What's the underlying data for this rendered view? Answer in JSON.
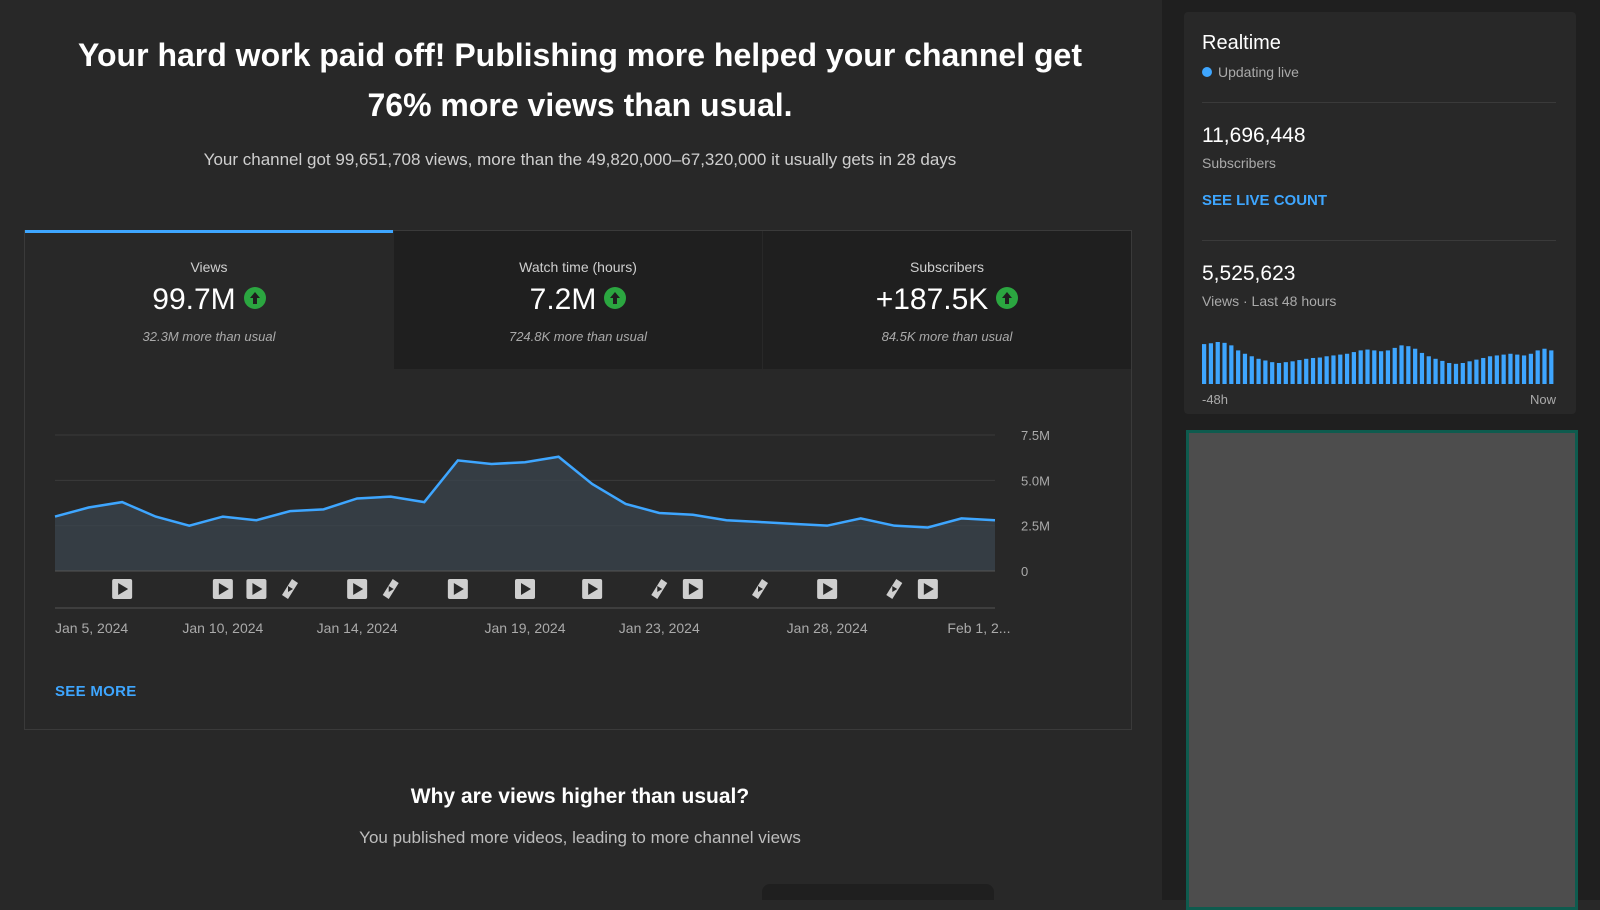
{
  "headline": "Your hard work paid off! Publishing more helped your channel get 76% more views than usual.",
  "subline": "Your channel got 99,651,708 views, more than the 49,820,000–67,320,000 it usually gets in 28 days",
  "metrics": [
    {
      "label": "Views",
      "value": "99.7M",
      "note": "32.3M more than usual",
      "trend": "up"
    },
    {
      "label": "Watch time (hours)",
      "value": "7.2M",
      "note": "724.8K more than usual",
      "trend": "up"
    },
    {
      "label": "Subscribers",
      "value": "+187.5K",
      "note": "84.5K more than usual",
      "trend": "up"
    }
  ],
  "chart_data": {
    "type": "area",
    "series": [
      {
        "values": [
          3.0,
          3.5,
          3.8,
          3.0,
          2.5,
          3.0,
          2.8,
          3.3,
          3.4,
          4.0,
          4.1,
          3.8,
          6.1,
          5.9,
          6.0,
          6.3,
          4.8,
          3.7,
          3.2,
          3.1,
          2.8,
          2.7,
          2.6,
          2.5,
          2.9,
          2.5,
          2.4,
          2.9,
          2.8
        ]
      }
    ],
    "x_labels": [
      "Jan 5, 2024",
      "Jan 10, 2024",
      "Jan 14, 2024",
      "Jan 19, 2024",
      "Jan 23, 2024",
      "Jan 28, 2024",
      "Feb 1, 2..."
    ],
    "y_ticks": [
      "7.5M",
      "5.0M",
      "2.5M",
      "0"
    ],
    "ylim": [
      0,
      7.5
    ],
    "grid": true,
    "upload_markers": [
      {
        "day": 2,
        "kind": "video"
      },
      {
        "day": 5,
        "kind": "video"
      },
      {
        "day": 6,
        "kind": "video"
      },
      {
        "day": 7,
        "kind": "short"
      },
      {
        "day": 9,
        "kind": "video"
      },
      {
        "day": 10,
        "kind": "short"
      },
      {
        "day": 12,
        "kind": "video"
      },
      {
        "day": 14,
        "kind": "video"
      },
      {
        "day": 16,
        "kind": "video"
      },
      {
        "day": 18,
        "kind": "short"
      },
      {
        "day": 19,
        "kind": "video"
      },
      {
        "day": 21,
        "kind": "short"
      },
      {
        "day": 23,
        "kind": "video"
      },
      {
        "day": 25,
        "kind": "short"
      },
      {
        "day": 26,
        "kind": "video"
      }
    ],
    "line_color": "#3ea6ff"
  },
  "see_more_label": "SEE MORE",
  "why": {
    "title": "Why are views higher than usual?",
    "subtitle": "You published more videos, leading to more channel views"
  },
  "realtime": {
    "title": "Realtime",
    "status": "Updating live",
    "subscribers_value": "11,696,448",
    "subscribers_label": "Subscribers",
    "live_count_link": "SEE LIVE COUNT",
    "views_value": "5,525,623",
    "views_label": "Views · Last 48 hours",
    "axis_start": "-48h",
    "axis_end": "Now",
    "bars": [
      0.95,
      0.97,
      1.0,
      0.98,
      0.92,
      0.8,
      0.72,
      0.66,
      0.6,
      0.56,
      0.52,
      0.5,
      0.52,
      0.54,
      0.57,
      0.6,
      0.62,
      0.63,
      0.66,
      0.68,
      0.7,
      0.72,
      0.76,
      0.8,
      0.82,
      0.8,
      0.78,
      0.8,
      0.86,
      0.92,
      0.9,
      0.84,
      0.74,
      0.66,
      0.6,
      0.55,
      0.5,
      0.48,
      0.5,
      0.54,
      0.58,
      0.62,
      0.66,
      0.68,
      0.7,
      0.72,
      0.7,
      0.68,
      0.72,
      0.8,
      0.84,
      0.8
    ]
  },
  "colors": {
    "accent": "#3ea6ff",
    "up": "#2ba640",
    "panel_border": "#0e5b4e"
  }
}
